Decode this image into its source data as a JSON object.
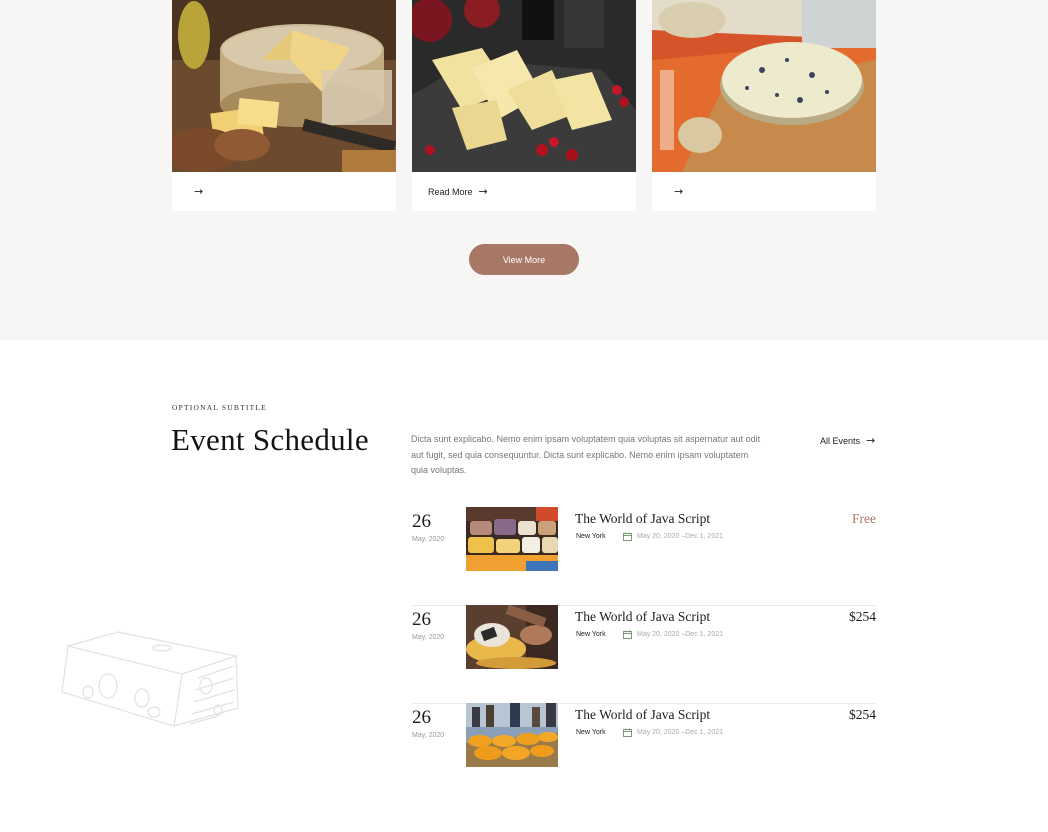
{
  "cards": [
    {
      "image": "cheese-wheel-photo",
      "read_more_label": "",
      "arrow": "→"
    },
    {
      "image": "cheese-cubes-pomegranate-photo",
      "read_more_label": "Read More",
      "arrow": "→"
    },
    {
      "image": "blue-cheese-board-photo",
      "read_more_label": "",
      "arrow": "→"
    }
  ],
  "view_more_label": "View More",
  "events_section": {
    "subtitle": "OPTIONAL SUBTITLE",
    "title": "Event Schedule",
    "description": "Dicta sunt explicabo. Nemo enim ipsam voluptatem quia voluptas sit aspernatur aut odit aut fugit, sed quia consequuntur. Dicta sunt explicabo. Nemo enim ipsam voluptatem quia voluptas.",
    "all_events_label": "All Events",
    "arrow": "→"
  },
  "events": [
    {
      "day": "26",
      "month_year": "May, 2020",
      "title": "The World of Java Script",
      "location": "New York",
      "date_range": "May 20, 2020 –Dec 1, 2021",
      "price": "Free",
      "image": "cheese-market-photo"
    },
    {
      "day": "26",
      "month_year": "May, 2020",
      "title": "The World of Java Script",
      "location": "New York",
      "date_range": "May 20, 2020 –Dec 1, 2021",
      "price": "$254",
      "image": "cheese-making-photo"
    },
    {
      "day": "26",
      "month_year": "May, 2020",
      "title": "The World of Java Script",
      "location": "New York",
      "date_range": "May 20, 2020 –Dec 1, 2021",
      "price": "$254",
      "image": "cheese-wheels-market-photo"
    }
  ],
  "colors": {
    "accent": "#a87866",
    "section_bg": "#f8f5f5"
  },
  "icons": {
    "arrow": "arrow-right-icon",
    "calendar": "calendar-icon"
  }
}
